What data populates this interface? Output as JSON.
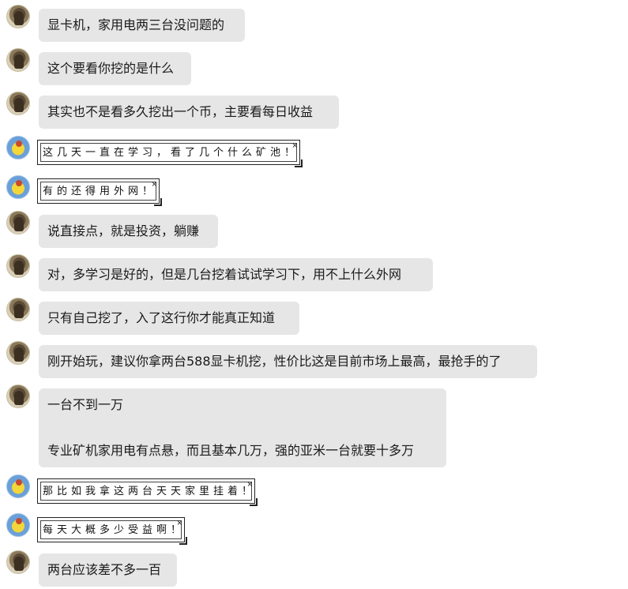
{
  "messages": [
    {
      "sender": "a",
      "type": "bubble",
      "text": "显卡机，家用电两三台没问题的"
    },
    {
      "sender": "a",
      "type": "bubble",
      "text": "这个要看你挖的是什么"
    },
    {
      "sender": "a",
      "type": "bubble",
      "text": "其实也不是看多久挖出一个币，主要看每日收益"
    },
    {
      "sender": "b",
      "type": "card",
      "text": "这几天一直在学习，看了几个什么矿池！"
    },
    {
      "sender": "b",
      "type": "card",
      "text": "有的还得用外网！"
    },
    {
      "sender": "a",
      "type": "bubble",
      "text": "说直接点，就是投资，躺赚"
    },
    {
      "sender": "a",
      "type": "bubble",
      "text": "对，多学习是好的，但是几台挖着试试学习下，用不上什么外网"
    },
    {
      "sender": "a",
      "type": "bubble",
      "text": "只有自己挖了，入了这行你才能真正知道"
    },
    {
      "sender": "a",
      "type": "bubble",
      "text": "刚开始玩，建议你拿两台588显卡机挖，性价比这是目前市场上最高，最抢手的了"
    },
    {
      "sender": "a",
      "type": "bubble",
      "text": "一台不到一万",
      "text2": "专业矿机家用电有点悬，而且基本几万，强的亚米一台就要十多万"
    },
    {
      "sender": "b",
      "type": "card",
      "text": "那比如我拿这两台天天家里挂着！"
    },
    {
      "sender": "b",
      "type": "card",
      "text": "每天大概多少受益啊！"
    },
    {
      "sender": "a",
      "type": "bubble",
      "text": "两台应该差不多一百"
    }
  ],
  "colors": {
    "bubble_bg": "#e6e6e6",
    "text": "#1a1a1a",
    "page_bg": "#ffffff"
  },
  "icons": {
    "sender_a": "dark-figure-avatar-icon",
    "sender_b": "yellow-cartoon-avatar-icon"
  }
}
